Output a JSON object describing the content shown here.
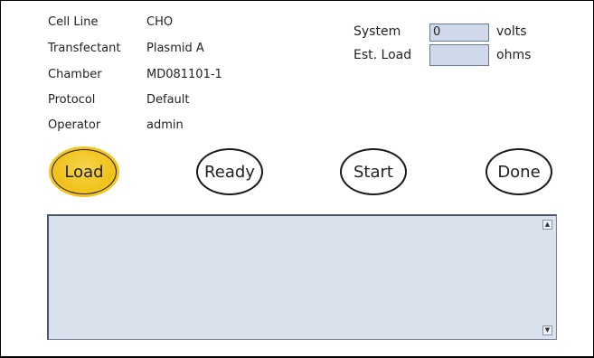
{
  "info": {
    "rows": [
      {
        "label": "Cell Line",
        "value": "CHO"
      },
      {
        "label": "Transfectant",
        "value": "Plasmid A"
      },
      {
        "label": "Chamber",
        "value": "MD081101-1"
      },
      {
        "label": "Protocol",
        "value": "Default"
      },
      {
        "label": "Operator",
        "value": "admin"
      }
    ]
  },
  "system": {
    "system_label": "System",
    "system_value": "0",
    "system_unit": "volts",
    "load_label": "Est. Load",
    "load_value": "",
    "load_unit": "ohms"
  },
  "steps": {
    "load": "Load",
    "ready": "Ready",
    "start": "Start",
    "done": "Done",
    "active": "Load"
  },
  "log": {
    "text": "",
    "scroll_up_icon": "scroll-up-arrow",
    "scroll_down_icon": "scroll-down-arrow"
  },
  "colors": {
    "active_step": "#f0c420",
    "field_bg": "#cfd9ea",
    "log_bg": "#d9e1ec"
  }
}
